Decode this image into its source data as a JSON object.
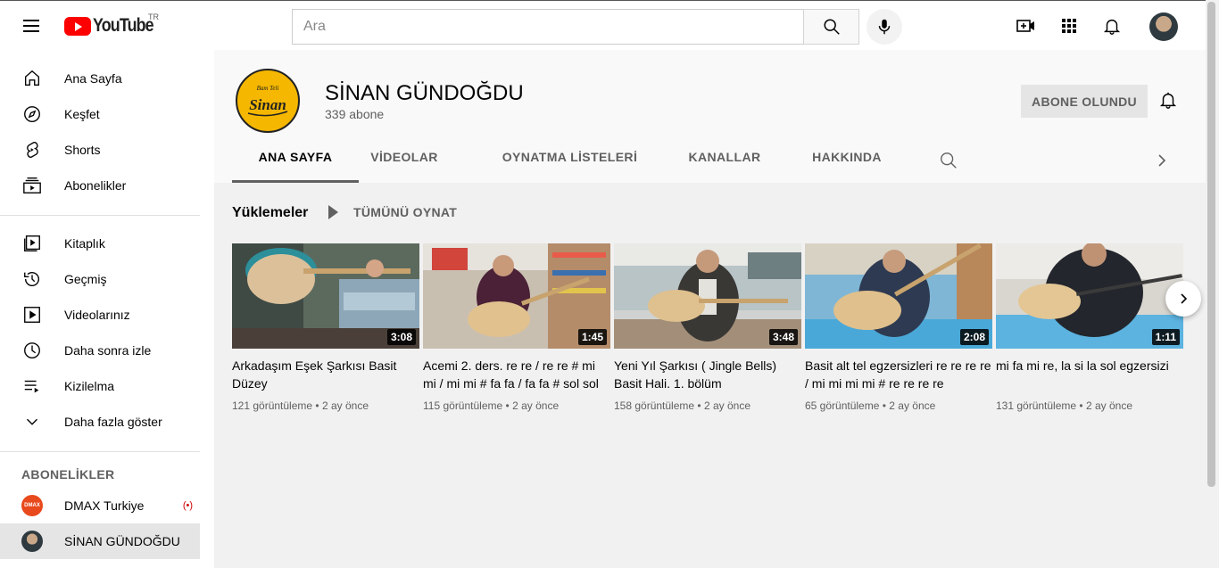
{
  "header": {
    "logo_text": "YouTube",
    "country_code": "TR",
    "search_placeholder": "Ara"
  },
  "sidebar": {
    "items": [
      {
        "label": "Ana Sayfa",
        "icon": "home-icon"
      },
      {
        "label": "Keşfet",
        "icon": "explore-icon"
      },
      {
        "label": "Shorts",
        "icon": "shorts-icon"
      },
      {
        "label": "Abonelikler",
        "icon": "subscriptions-icon"
      },
      {
        "label": "Kitaplık",
        "icon": "library-icon"
      },
      {
        "label": "Geçmiş",
        "icon": "history-icon"
      },
      {
        "label": "Videolarınız",
        "icon": "your-videos-icon"
      },
      {
        "label": "Daha sonra izle",
        "icon": "watch-later-icon"
      },
      {
        "label": "Kizilelma",
        "icon": "playlist-icon"
      },
      {
        "label": "Daha fazla göster",
        "icon": "chevron-down-icon"
      }
    ],
    "subscriptions_heading": "ABONELİKLER",
    "subscriptions": [
      {
        "name": "DMAX Turkiye",
        "live": "(•)"
      },
      {
        "name": "SİNAN GÜNDOĞDU"
      }
    ]
  },
  "channel": {
    "name": "SİNAN GÜNDOĞDU",
    "subscribers": "339 abone",
    "subscribe_label": "ABONE OLUNDU",
    "tabs": [
      "ANA SAYFA",
      "VİDEOLAR",
      "OYNATMA LİSTELERİ",
      "KANALLAR",
      "HAKKINDA"
    ],
    "active_tab": "ANA SAYFA"
  },
  "shelf": {
    "title": "Yüklemeler",
    "play_all": "TÜMÜNÜ OYNAT",
    "videos": [
      {
        "title": "Arkadaşım Eşek Şarkısı Basit Düzey",
        "duration": "3:08",
        "views": "121 görüntüleme",
        "age": "2 ay önce"
      },
      {
        "title": "Acemi 2. ders. re re / re re # mi mi / mi mi # fa fa / fa fa # sol sol",
        "duration": "1:45",
        "views": "115 görüntüleme",
        "age": "2 ay önce"
      },
      {
        "title": "Yeni Yıl Şarkısı ( Jingle Bells) Basit Hali. 1. bölüm",
        "duration": "3:48",
        "views": "158 görüntüleme",
        "age": "2 ay önce"
      },
      {
        "title": "Basit alt tel egzersizleri re re re re / mi mi mi mi # re re re re",
        "duration": "2:08",
        "views": "65 görüntüleme",
        "age": "2 ay önce"
      },
      {
        "title": "mi fa mi re, la si la sol egzersizi",
        "duration": "1:11",
        "views": "131 görüntüleme",
        "age": "2 ay önce"
      }
    ]
  },
  "meta_separator": "•",
  "colors": {
    "brand_red": "#ff0000",
    "logo_badge": "#f5b700",
    "text_secondary": "#606060"
  }
}
